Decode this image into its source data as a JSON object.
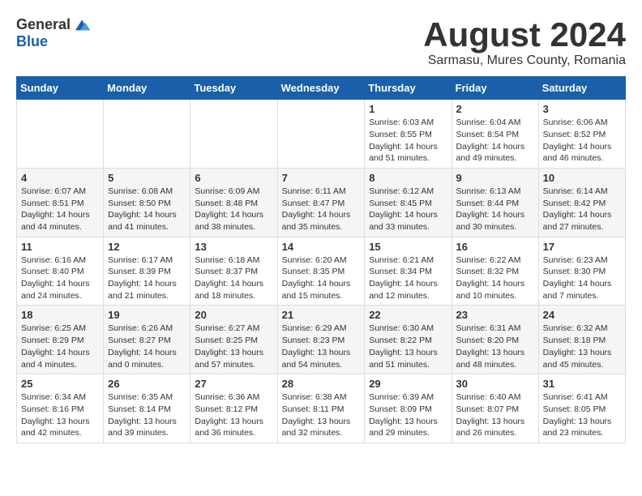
{
  "header": {
    "logo_general": "General",
    "logo_blue": "Blue",
    "month_title": "August 2024",
    "location": "Sarmasu, Mures County, Romania"
  },
  "weekdays": [
    "Sunday",
    "Monday",
    "Tuesday",
    "Wednesday",
    "Thursday",
    "Friday",
    "Saturday"
  ],
  "weeks": [
    [
      {
        "day": "",
        "info": ""
      },
      {
        "day": "",
        "info": ""
      },
      {
        "day": "",
        "info": ""
      },
      {
        "day": "",
        "info": ""
      },
      {
        "day": "1",
        "info": "Sunrise: 6:03 AM\nSunset: 8:55 PM\nDaylight: 14 hours and 51 minutes."
      },
      {
        "day": "2",
        "info": "Sunrise: 6:04 AM\nSunset: 8:54 PM\nDaylight: 14 hours and 49 minutes."
      },
      {
        "day": "3",
        "info": "Sunrise: 6:06 AM\nSunset: 8:52 PM\nDaylight: 14 hours and 46 minutes."
      }
    ],
    [
      {
        "day": "4",
        "info": "Sunrise: 6:07 AM\nSunset: 8:51 PM\nDaylight: 14 hours and 44 minutes."
      },
      {
        "day": "5",
        "info": "Sunrise: 6:08 AM\nSunset: 8:50 PM\nDaylight: 14 hours and 41 minutes."
      },
      {
        "day": "6",
        "info": "Sunrise: 6:09 AM\nSunset: 8:48 PM\nDaylight: 14 hours and 38 minutes."
      },
      {
        "day": "7",
        "info": "Sunrise: 6:11 AM\nSunset: 8:47 PM\nDaylight: 14 hours and 35 minutes."
      },
      {
        "day": "8",
        "info": "Sunrise: 6:12 AM\nSunset: 8:45 PM\nDaylight: 14 hours and 33 minutes."
      },
      {
        "day": "9",
        "info": "Sunrise: 6:13 AM\nSunset: 8:44 PM\nDaylight: 14 hours and 30 minutes."
      },
      {
        "day": "10",
        "info": "Sunrise: 6:14 AM\nSunset: 8:42 PM\nDaylight: 14 hours and 27 minutes."
      }
    ],
    [
      {
        "day": "11",
        "info": "Sunrise: 6:16 AM\nSunset: 8:40 PM\nDaylight: 14 hours and 24 minutes."
      },
      {
        "day": "12",
        "info": "Sunrise: 6:17 AM\nSunset: 8:39 PM\nDaylight: 14 hours and 21 minutes."
      },
      {
        "day": "13",
        "info": "Sunrise: 6:18 AM\nSunset: 8:37 PM\nDaylight: 14 hours and 18 minutes."
      },
      {
        "day": "14",
        "info": "Sunrise: 6:20 AM\nSunset: 8:35 PM\nDaylight: 14 hours and 15 minutes."
      },
      {
        "day": "15",
        "info": "Sunrise: 6:21 AM\nSunset: 8:34 PM\nDaylight: 14 hours and 12 minutes."
      },
      {
        "day": "16",
        "info": "Sunrise: 6:22 AM\nSunset: 8:32 PM\nDaylight: 14 hours and 10 minutes."
      },
      {
        "day": "17",
        "info": "Sunrise: 6:23 AM\nSunset: 8:30 PM\nDaylight: 14 hours and 7 minutes."
      }
    ],
    [
      {
        "day": "18",
        "info": "Sunrise: 6:25 AM\nSunset: 8:29 PM\nDaylight: 14 hours and 4 minutes."
      },
      {
        "day": "19",
        "info": "Sunrise: 6:26 AM\nSunset: 8:27 PM\nDaylight: 14 hours and 0 minutes."
      },
      {
        "day": "20",
        "info": "Sunrise: 6:27 AM\nSunset: 8:25 PM\nDaylight: 13 hours and 57 minutes."
      },
      {
        "day": "21",
        "info": "Sunrise: 6:29 AM\nSunset: 8:23 PM\nDaylight: 13 hours and 54 minutes."
      },
      {
        "day": "22",
        "info": "Sunrise: 6:30 AM\nSunset: 8:22 PM\nDaylight: 13 hours and 51 minutes."
      },
      {
        "day": "23",
        "info": "Sunrise: 6:31 AM\nSunset: 8:20 PM\nDaylight: 13 hours and 48 minutes."
      },
      {
        "day": "24",
        "info": "Sunrise: 6:32 AM\nSunset: 8:18 PM\nDaylight: 13 hours and 45 minutes."
      }
    ],
    [
      {
        "day": "25",
        "info": "Sunrise: 6:34 AM\nSunset: 8:16 PM\nDaylight: 13 hours and 42 minutes."
      },
      {
        "day": "26",
        "info": "Sunrise: 6:35 AM\nSunset: 8:14 PM\nDaylight: 13 hours and 39 minutes."
      },
      {
        "day": "27",
        "info": "Sunrise: 6:36 AM\nSunset: 8:12 PM\nDaylight: 13 hours and 36 minutes."
      },
      {
        "day": "28",
        "info": "Sunrise: 6:38 AM\nSunset: 8:11 PM\nDaylight: 13 hours and 32 minutes."
      },
      {
        "day": "29",
        "info": "Sunrise: 6:39 AM\nSunset: 8:09 PM\nDaylight: 13 hours and 29 minutes."
      },
      {
        "day": "30",
        "info": "Sunrise: 6:40 AM\nSunset: 8:07 PM\nDaylight: 13 hours and 26 minutes."
      },
      {
        "day": "31",
        "info": "Sunrise: 6:41 AM\nSunset: 8:05 PM\nDaylight: 13 hours and 23 minutes."
      }
    ]
  ]
}
